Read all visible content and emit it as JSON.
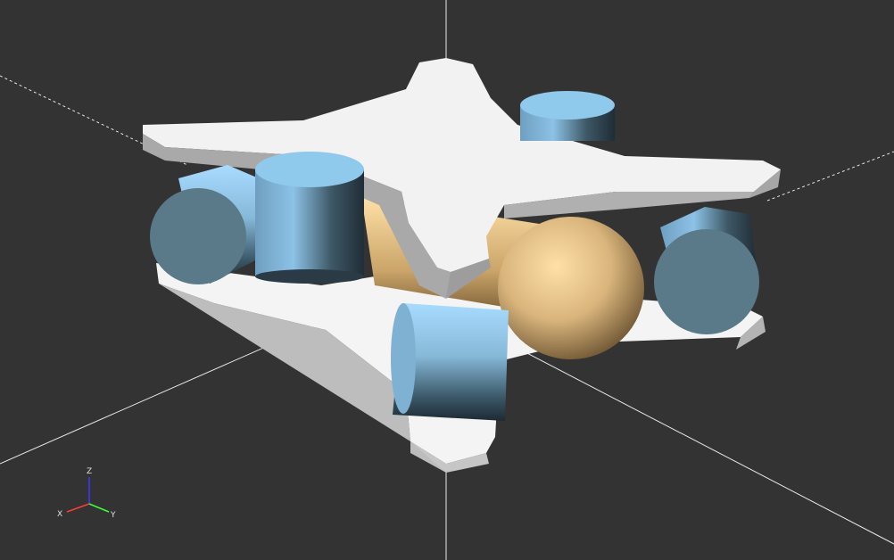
{
  "viewport": {
    "background": "#333333",
    "model_colors": {
      "plate_top": "#f2f2f2",
      "plate_side": "#a6a6a6",
      "cylinder_top": "#8fc9ec",
      "cylinder_face": "#5a7a8a",
      "sphere": "#f2cf8e"
    }
  },
  "axes_gizmo": {
    "z_label": "Z",
    "x_label": "X",
    "y_label": "Y",
    "z_color": "#3a3aff",
    "x_color": "#ff3a3a",
    "y_color": "#3aff3a"
  }
}
